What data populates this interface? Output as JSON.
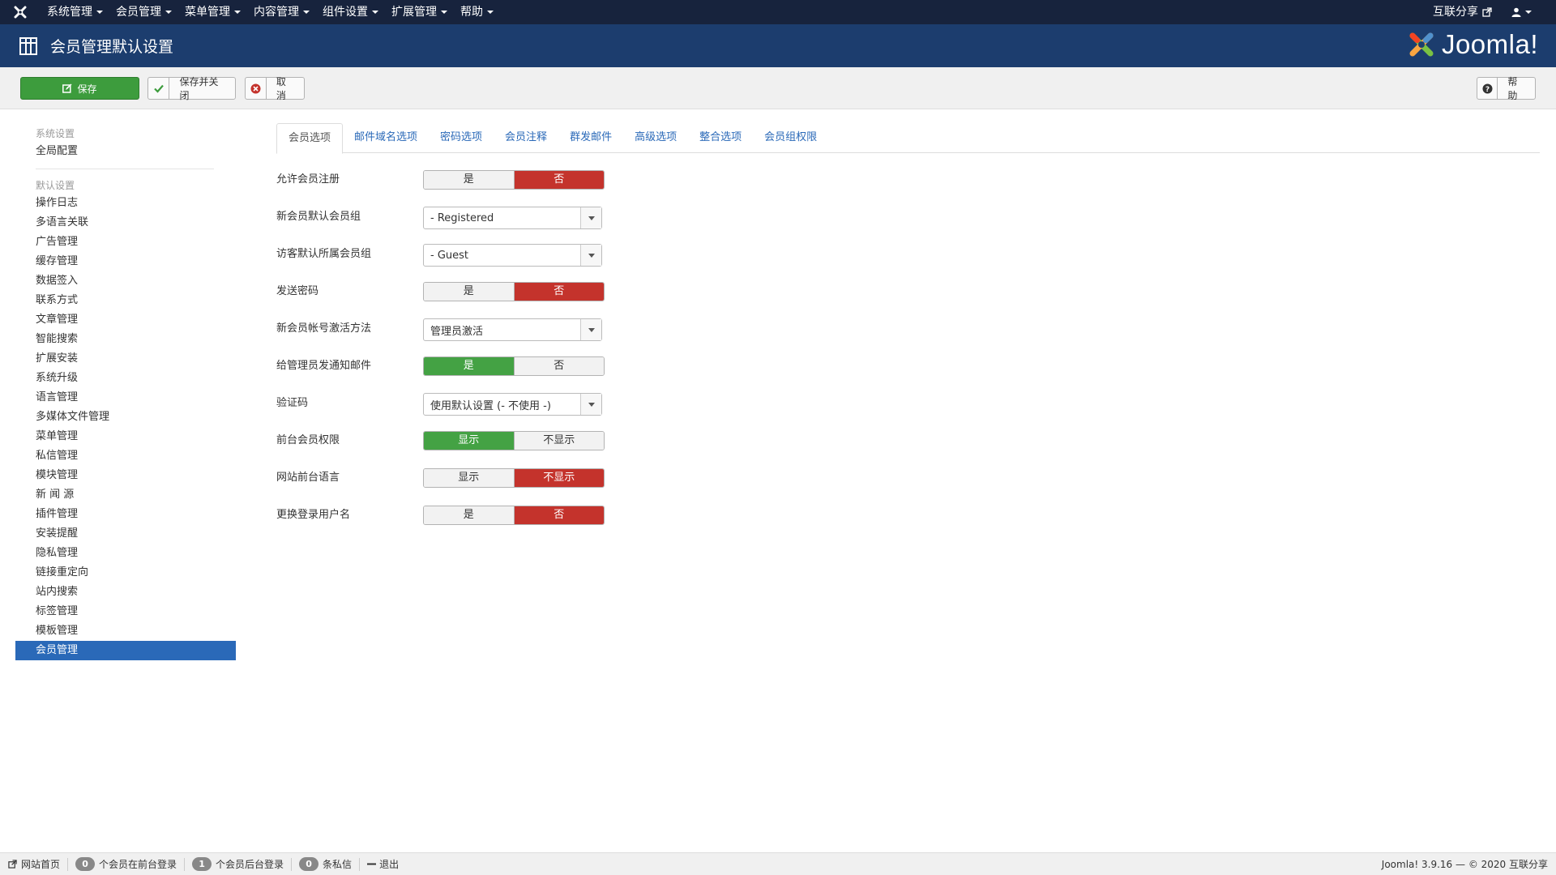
{
  "navbar": {
    "menus": [
      "系统管理",
      "会员管理",
      "菜单管理",
      "内容管理",
      "组件设置",
      "扩展管理",
      "帮助"
    ],
    "site_link": "互联分享"
  },
  "header": {
    "title": "会员管理默认设置",
    "brand": "Joomla!"
  },
  "toolbar": {
    "save": "保存",
    "save_close": "保存并关闭",
    "cancel": "取消",
    "help": "帮助"
  },
  "sidebar": {
    "system_header": "系统设置",
    "system_items": [
      "全局配置"
    ],
    "default_header": "默认设置",
    "default_items": [
      "操作日志",
      "多语言关联",
      "广告管理",
      "缓存管理",
      "数据签入",
      "联系方式",
      "文章管理",
      "智能搜索",
      "扩展安装",
      "系统升级",
      "语言管理",
      "多媒体文件管理",
      "菜单管理",
      "私信管理",
      "模块管理",
      "新 闻 源",
      "插件管理",
      "安装提醒",
      "隐私管理",
      "链接重定向",
      "站内搜索",
      "标签管理",
      "模板管理",
      "会员管理"
    ],
    "active_item": "会员管理"
  },
  "tabs": [
    "会员选项",
    "邮件域名选项",
    "密码选项",
    "会员注释",
    "群发邮件",
    "高级选项",
    "整合选项",
    "会员组权限"
  ],
  "active_tab": "会员选项",
  "form": {
    "allow_registration": {
      "label": "允许会员注册",
      "options": [
        "是",
        "否"
      ],
      "selected": "否"
    },
    "new_user_group": {
      "label": "新会员默认会员组",
      "value": "- Registered"
    },
    "guest_group": {
      "label": "访客默认所属会员组",
      "value": "- Guest"
    },
    "send_password": {
      "label": "发送密码",
      "options": [
        "是",
        "否"
      ],
      "selected": "否"
    },
    "activation": {
      "label": "新会员帐号激活方法",
      "value": "管理员激活"
    },
    "notify_admin": {
      "label": "给管理员发通知邮件",
      "options": [
        "是",
        "否"
      ],
      "selected": "是"
    },
    "captcha": {
      "label": "验证码",
      "value": "使用默认设置 (- 不使用 -)"
    },
    "frontend_permissions": {
      "label": "前台会员权限",
      "options": [
        "显示",
        "不显示"
      ],
      "selected": "显示"
    },
    "frontend_language": {
      "label": "网站前台语言",
      "options": [
        "显示",
        "不显示"
      ],
      "selected": "不显示"
    },
    "change_username": {
      "label": "更换登录用户名",
      "options": [
        "是",
        "否"
      ],
      "selected": "否"
    }
  },
  "statusbar": {
    "site_home": "网站首页",
    "frontend_count": "0",
    "frontend_label": "个会员在前台登录",
    "backend_count": "1",
    "backend_label": "个会员后台登录",
    "messages_count": "0",
    "messages_label": "条私信",
    "logout": "退出",
    "copyright": "Joomla! 3.9.16 — © 2020 互联分享"
  },
  "colors": {
    "navbar": "#17233d",
    "header": "#1c3d6e",
    "save_green": "#3d9c3d",
    "toggle_red": "#c4332c",
    "toggle_green": "#44a244",
    "active_blue": "#2a69b8"
  }
}
